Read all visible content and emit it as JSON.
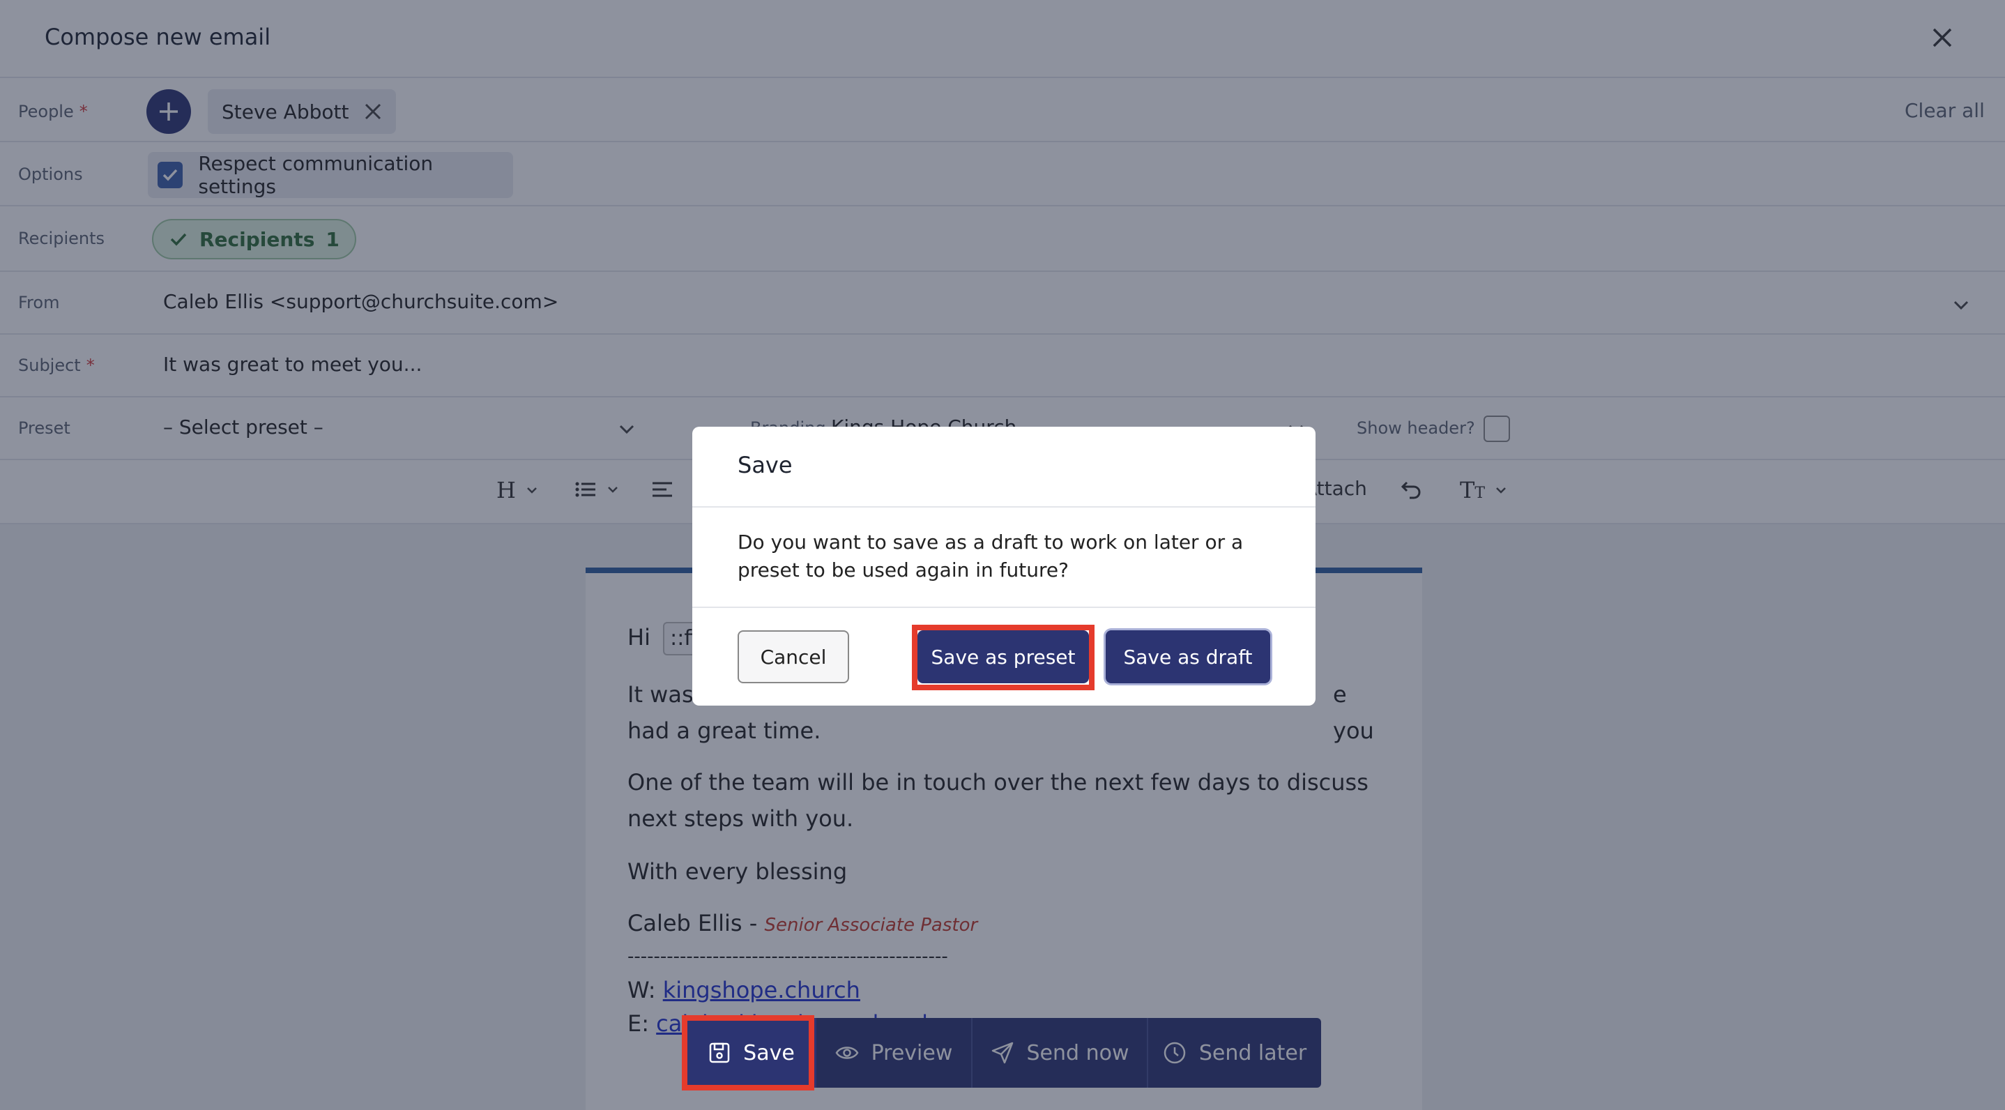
{
  "header": {
    "title": "Compose new email"
  },
  "people": {
    "label": "People",
    "required_mark": "*",
    "chip": "Steve Abbott",
    "clear_all": "Clear all"
  },
  "options": {
    "label": "Options",
    "checkbox_label": "Respect communication settings",
    "checked": true
  },
  "recipients": {
    "label": "Recipients",
    "badge_text": "Recipients",
    "count": "1"
  },
  "from": {
    "label": "From",
    "value": "Caleb Ellis <support@churchsuite.com>"
  },
  "subject": {
    "label": "Subject",
    "required_mark": "*",
    "value": "It was great to meet you..."
  },
  "preset": {
    "label": "Preset",
    "select_value": "– Select preset –",
    "branding_label": "Branding",
    "branding_value": "Kings Hope Church",
    "show_header_label": "Show header?"
  },
  "toolbar": {
    "attach_label": "Attach"
  },
  "email_body": {
    "greeting": "Hi",
    "merge_field": "::firstname::",
    "para1_start": "It was",
    "para1_end": "e you",
    "para1_line2": "had a great time.",
    "para2": "One of the team will be in touch over the next few days to discuss next steps with you.",
    "closing": "With every blessing",
    "signature_name": "Caleb Ellis -",
    "signature_role": "Senior Associate Pastor",
    "divider": "-------------------------------------------------",
    "web_label": "W:",
    "web_link": "kingshope.church",
    "email_label": "E:",
    "email_link": "caleb@kingshope.church"
  },
  "modal": {
    "title": "Save",
    "body": "Do you want to save as a draft to work on later or a preset to be used again in future?",
    "cancel": "Cancel",
    "save_preset": "Save as preset",
    "save_draft": "Save as draft"
  },
  "actions": {
    "save": "Save",
    "preview": "Preview",
    "send_now": "Send now",
    "send_later": "Send later"
  },
  "colors": {
    "primary": "#2c3472",
    "highlight": "#e53b2c",
    "success_bg": "#dff2e0"
  }
}
